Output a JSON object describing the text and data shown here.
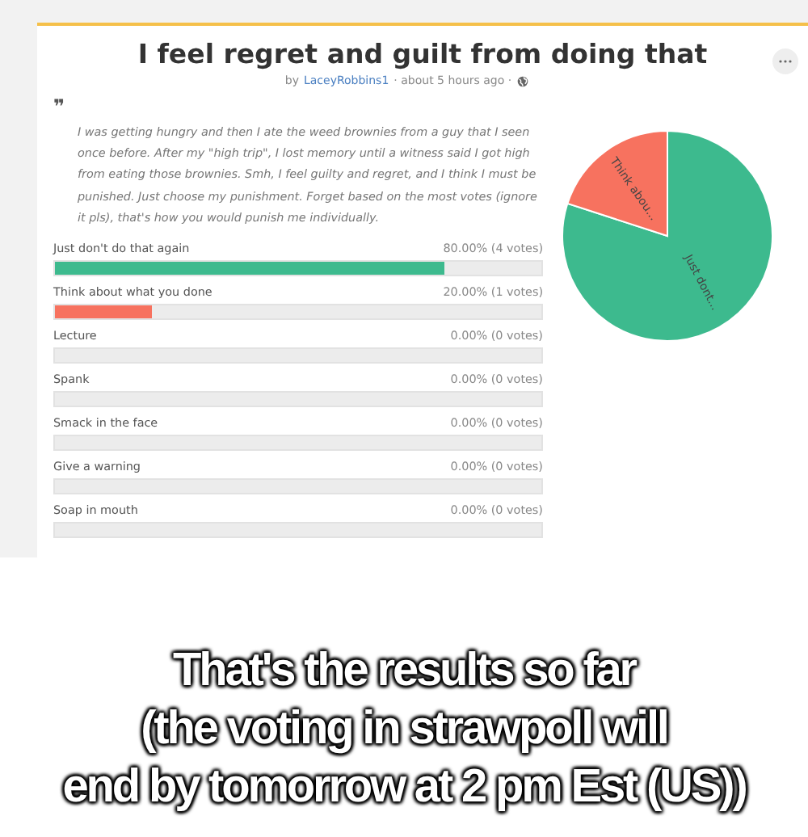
{
  "poll": {
    "title": "I feel regret and guilt from doing that",
    "byline": {
      "prefix": "by",
      "author": "LaceyRobbins1",
      "time": "· about 5 hours ago ·"
    },
    "quote_mark": "❞",
    "description": "I was getting hungry and then I ate the weed brownies from a guy that I seen once before. After my \"high trip\", I lost memory until a witness said I got high from eating those brownies. Smh, I feel guilty and regret, and I think I must be punished. Just choose my punishment. Forget based on the most votes (ignore it pls), that's how you would punish me individually.",
    "options": [
      {
        "label": "Just don't do that again",
        "result": "80.00% (4 votes)",
        "level": 0.8,
        "color": "#3dba8e"
      },
      {
        "label": "Think about what you done",
        "result": "20.00% (1 votes)",
        "level": 0.2,
        "color": "#f7725f"
      },
      {
        "label": "Lecture",
        "result": "0.00% (0 votes)"
      },
      {
        "label": "Spank",
        "result": "0.00% (0 votes)"
      },
      {
        "label": "Smack in the face",
        "result": "0.00% (0 votes)"
      },
      {
        "label": "Give a warning",
        "result": "0.00% (0 votes)"
      },
      {
        "label": "Soap in mouth",
        "result": "0.00% (0 votes)"
      }
    ],
    "chart_data": {
      "type": "pie",
      "categories": [
        "Just dont...",
        "Think abou..."
      ],
      "values": [
        80,
        20
      ]
    }
  },
  "caption_lines": [
    "That's the results so far",
    "(the voting in strawpoll will",
    "end by tomorrow at 2 pm Est (US))"
  ]
}
